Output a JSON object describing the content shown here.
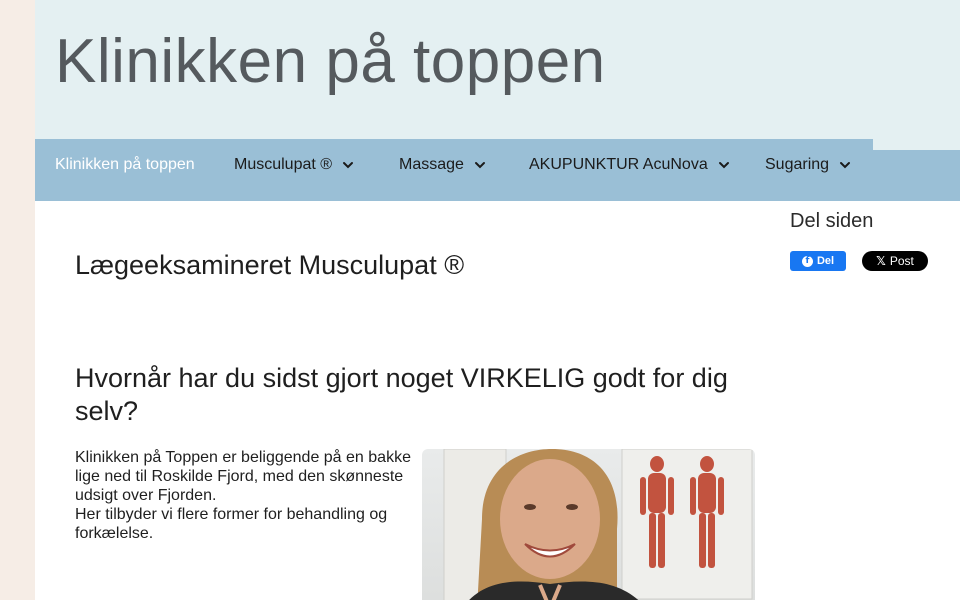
{
  "header": {
    "site_title": "Klinikken på toppen"
  },
  "nav": {
    "items": [
      {
        "label": "Klinikken på toppen",
        "has_dropdown": false,
        "active": true
      },
      {
        "label": "Musculupat ®",
        "has_dropdown": true
      },
      {
        "label": "Massage",
        "has_dropdown": true
      },
      {
        "label": "AKUPUNKTUR AcuNova",
        "has_dropdown": true
      },
      {
        "label": "Sugaring",
        "has_dropdown": true
      }
    ]
  },
  "main": {
    "page_title": "Lægeeksamineret Musculupat ®",
    "section_heading": "Hvornår har du sidst gjort noget VIRKELIG godt for dig selv?",
    "intro_lines": [
      "Klinikken på Toppen er beliggende på en bakke lige ned til Roskilde Fjord, med den skønneste udsigt over Fjorden.",
      "Her tilbyder vi flere former for behandling og forkælelse."
    ]
  },
  "sidebar": {
    "share_title": "Del siden",
    "facebook_label": "Del",
    "x_label": "Post"
  },
  "colors": {
    "page_bg": "#f6ede6",
    "header_bg": "#e4f0f2",
    "nav_bg": "#9abfd6",
    "facebook_blue": "#1877f2"
  },
  "icons": {
    "nav_dropdown": "chevron-down-icon",
    "facebook": "facebook-icon",
    "x": "x-icon"
  }
}
